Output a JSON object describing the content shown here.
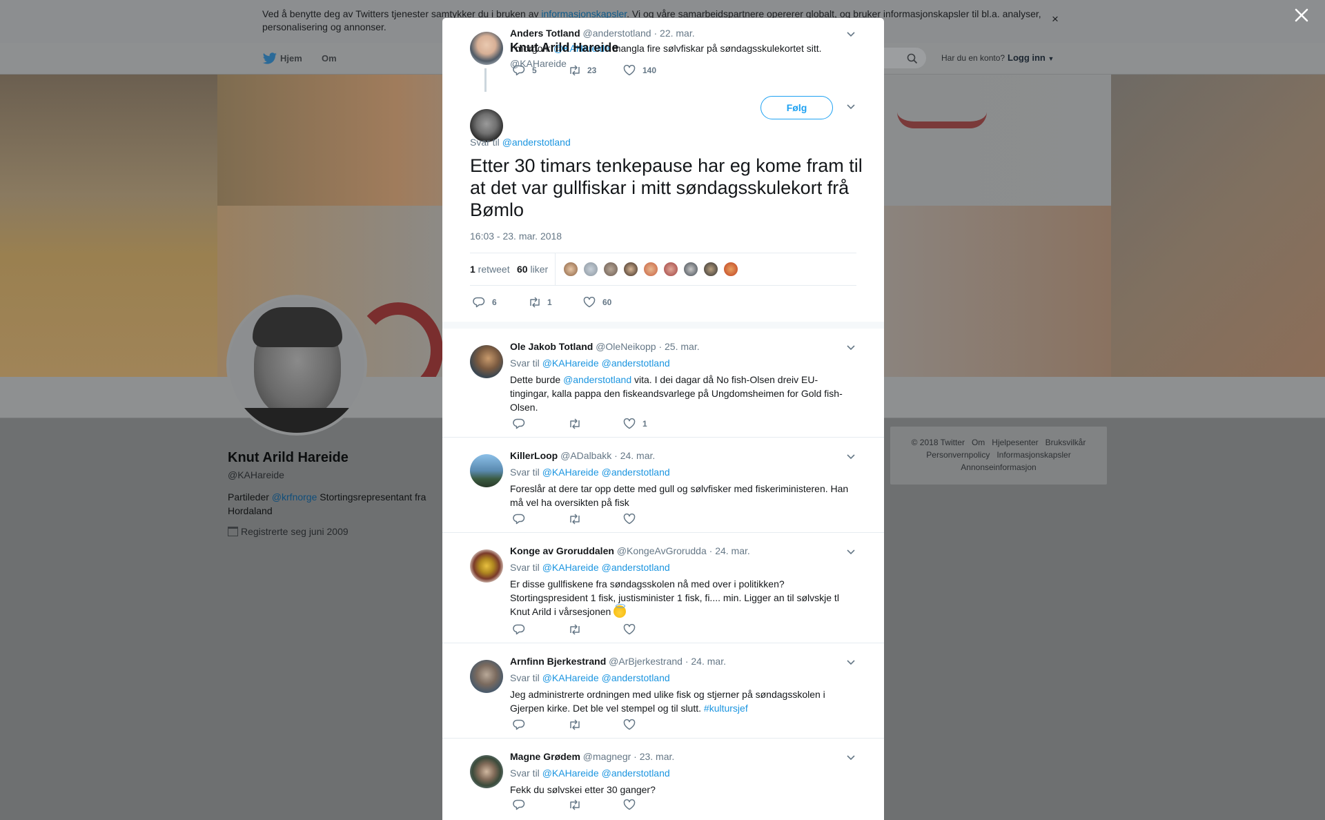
{
  "cookie": {
    "text_before": "Ved å benytte deg av Twitters tjenester samtykker du i bruken av ",
    "link": "informasjonskapsler",
    "text_after": ". Vi og våre samarbeidspartnere opererer globalt, og bruker informasjonskapsler til bl.a. analyser, personalisering og annonser.",
    "close": "×"
  },
  "nav": {
    "home": "Hjem",
    "about": "Om",
    "account_question": "Har du en konto?",
    "login": "Logg inn"
  },
  "profile": {
    "name": "Knut Arild Hareide",
    "handle": "@KAHareide",
    "bio_before": "Partileder ",
    "bio_link": "@krfnorge",
    "bio_after": " Stortingsrepresentant fra Hordaland",
    "joined": "Registrerte seg juni 2009"
  },
  "footer": {
    "links": [
      "© 2018 Twitter",
      "Om",
      "Hjelpesenter",
      "Bruksvilkår",
      "Personvernpolicy",
      "Informasjonskapsler",
      "Annonseinformasjon"
    ]
  },
  "parent_tweet": {
    "name": "Anders Totland",
    "handle": "@anderstotland",
    "time": "· 22. mar.",
    "text_before": "I morgon: ",
    "mention": "@KAHareide",
    "text_after": " mangla fire sølvfiskar på søndagsskulekortet sitt.",
    "replies": "5",
    "retweets": "23",
    "likes": "140"
  },
  "main_tweet": {
    "name": "Knut Arild Hareide",
    "handle": "@KAHareide",
    "follow_label": "Følg",
    "reply_to_label": "Svar til ",
    "reply_to": "@anderstotland",
    "text": "Etter 30 timars tenkepause har eg kome fram til at det var gullfiskar i mitt søndagsskulekort frå Bømlo",
    "timestamp": "16:03 - 23. mar. 2018",
    "retweet_count": "1",
    "retweet_label": " retweet",
    "like_count": "60",
    "like_label": " liker",
    "replies": "6",
    "retweets": "1",
    "likes": "60"
  },
  "replies": [
    {
      "name": "Ole Jakob Totland",
      "handle": "@OleNeikopp",
      "time": "· 25. mar.",
      "reply_label": "Svar til",
      "mentions": [
        "@KAHareide",
        "@anderstotland"
      ],
      "text_before": "Dette burde ",
      "text_mention": "@anderstotland",
      "text_after": " vita. I dei dagar då No fish-Olsen dreiv EU-tingingar, kalla pappa den fiskeandsvarlege på Ungdomsheimen for Gold fish-Olsen.",
      "likes": "1"
    },
    {
      "name": "KillerLoop",
      "handle": "@ADalbakk",
      "time": "· 24. mar.",
      "reply_label": "Svar til",
      "mentions": [
        "@KAHareide",
        "@anderstotland"
      ],
      "text": "Foreslår at dere tar opp dette med gull og sølvfisker med fiskeriministeren. Han må vel ha oversikten på fisk"
    },
    {
      "name": "Konge av Groruddalen",
      "handle": "@KongeAvGrorudda",
      "time": "· 24. mar.",
      "reply_label": "Svar til",
      "mentions": [
        "@KAHareide",
        "@anderstotland"
      ],
      "text": "Er disse gullfiskene fra søndagsskolen nå med over i politikken? Stortingspresident 1 fisk, justisminister 1 fisk, fi.... min. Ligger an til sølvskje tl Knut Arild i vårsesjonen"
    },
    {
      "name": "Arnfinn Bjerkestrand",
      "handle": "@ArBjerkestrand",
      "time": "· 24. mar.",
      "reply_label": "Svar til",
      "mentions": [
        "@KAHareide",
        "@anderstotland"
      ],
      "text": "Jeg administrerte ordningen med ulike fisk og stjerner på søndagsskolen i Gjerpen kirke. Det ble vel stempel og til slutt. ",
      "hashtag": "#kultursjef"
    },
    {
      "name": "Magne Grødem",
      "handle": "@magnegr",
      "time": "· 23. mar.",
      "reply_label": "Svar til",
      "mentions": [
        "@KAHareide",
        "@anderstotland"
      ],
      "text": "Fekk du sølvskei etter 30 ganger?"
    }
  ],
  "colors": {
    "link": "#1b95e0",
    "follow": "#1da1f2",
    "muted": "#657786"
  }
}
